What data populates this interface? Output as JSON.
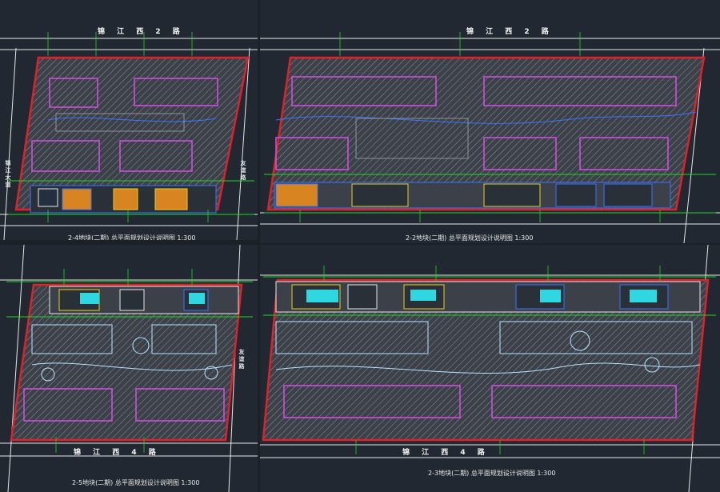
{
  "sheets": [
    {
      "id": "top-left",
      "road_north": "锦 江 西 2 路",
      "road_south": "",
      "title": "2-4地块(二期) 总平面规划设计说明图 1:300",
      "side_road_left": "锦 江 大 道",
      "side_road_right": "友 谊 路"
    },
    {
      "id": "top-right",
      "road_north": "锦 江 西 2 路",
      "road_south": "",
      "title": "2-2地块(二期) 总平面规划设计说明图 1:300",
      "side_road_left": "",
      "side_road_right": ""
    },
    {
      "id": "bottom-left",
      "road_north": "",
      "road_south": "锦 江 西 4 路",
      "title": "2-5地块(二期) 总平面规划设计说明图 1:300",
      "side_road_left": "",
      "side_road_right": "友 谊 路"
    },
    {
      "id": "bottom-right",
      "road_north": "",
      "road_south": "锦 江 西 4 路",
      "title": "2-3地块(二期) 总平面规划设计说明图 1:300",
      "side_road_left": "",
      "side_road_right": ""
    }
  ],
  "colors": {
    "background": "#222831",
    "boundary_red": "#e0202a",
    "green_line": "#19d81e",
    "building_magenta": "#d84de8",
    "hatch": "#9aa0a8",
    "road_white": "#e6e6e6",
    "blue_outline": "#3a74ff",
    "cyan": "#2fd8e0",
    "yellow": "#e8d020"
  }
}
